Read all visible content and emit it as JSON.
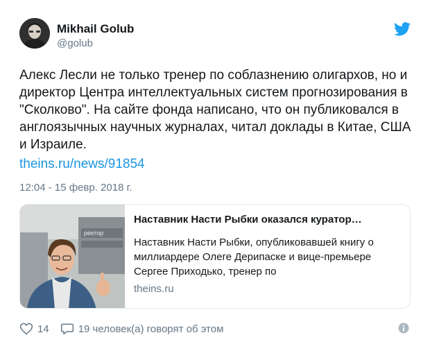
{
  "author": {
    "name": "Mikhail Golub",
    "handle": "@golub"
  },
  "tweet": {
    "text": "Алекс Лесли не только тренер по соблазнению олигархов, но и директор Центра интеллектуальных систем прогнозирования в \"Сколково\". На сайте фонда написано, что он публиковался в англоязычных научных журналах, читал доклады в Китае, США и Израиле.",
    "link": "theins.ru/news/91854",
    "timestamp": "12:04 - 15 февр. 2018 г."
  },
  "link_card": {
    "title": "Наставник Насти Рыбки оказался куратор…",
    "description": "Наставник Насти Рыбки, опубликовавшей книгу о миллиардере Олеге Дерипаске и вице-премьере Сергее Приходько, тренер по",
    "domain": "theins.ru",
    "image_sign_text": "ректор"
  },
  "actions": {
    "like_count": "14",
    "reply_text": "19 человек(а) говорят об этом"
  },
  "colors": {
    "link": "#1b95e0",
    "muted": "#657786",
    "border": "#e1e8ed",
    "twitter_blue": "#1da1f2"
  },
  "icons": {
    "brand": "twitter-bird-icon",
    "like": "heart-icon",
    "reply": "speech-bubble-icon",
    "info": "info-icon"
  }
}
